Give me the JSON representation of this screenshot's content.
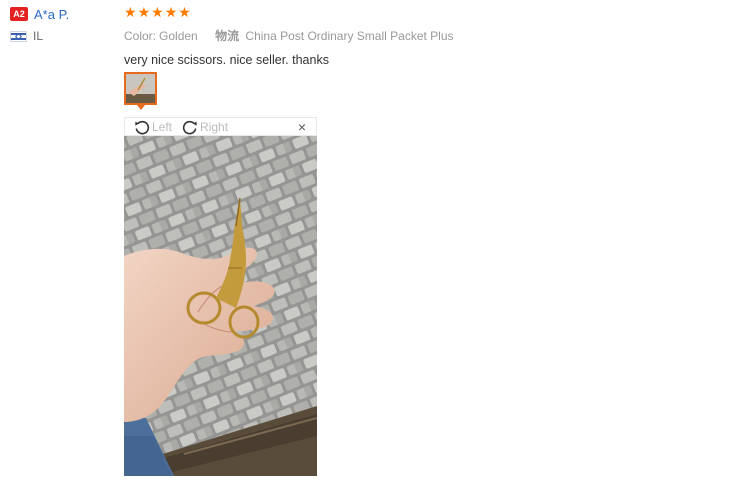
{
  "buyer": {
    "badge": "A2",
    "name": "A*a P.",
    "country_code": "IL",
    "flag_icon": "israel-flag-icon"
  },
  "review": {
    "rating": 5,
    "rating_max": 5,
    "star_color": "#ff7a00",
    "color_label": "Color:",
    "color_value": "Golden",
    "shipping_label": "物流",
    "shipping_value": "China Post Ordinary Small Packet Plus",
    "comment": "very nice scissors. nice seller. thanks"
  },
  "viewer": {
    "rotate_left_label": "Left",
    "rotate_right_label": "Right",
    "close_glyph": "×",
    "accent_color": "#e86a1c"
  }
}
